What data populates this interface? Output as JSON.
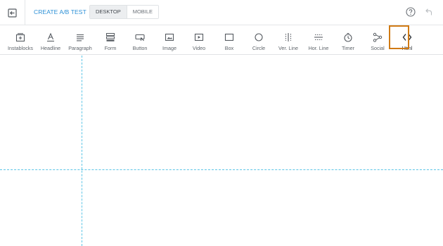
{
  "header": {
    "ab_test_label": "CREATE A/B TEST",
    "view_options": [
      "DESKTOP",
      "MOBILE"
    ],
    "active_view": "DESKTOP"
  },
  "toolbar": {
    "items": [
      {
        "label": "Instablocks",
        "icon": "instablocks-icon"
      },
      {
        "label": "Headline",
        "icon": "headline-icon"
      },
      {
        "label": "Paragraph",
        "icon": "paragraph-icon"
      },
      {
        "label": "Form",
        "icon": "form-icon"
      },
      {
        "label": "Button",
        "icon": "button-icon"
      },
      {
        "label": "Image",
        "icon": "image-icon"
      },
      {
        "label": "Video",
        "icon": "video-icon"
      },
      {
        "label": "Box",
        "icon": "box-icon"
      },
      {
        "label": "Circle",
        "icon": "circle-icon"
      },
      {
        "label": "Ver. Line",
        "icon": "vertical-line-icon"
      },
      {
        "label": "Hor. Line",
        "icon": "horizontal-line-icon"
      },
      {
        "label": "Timer",
        "icon": "timer-icon"
      },
      {
        "label": "Social",
        "icon": "social-icon"
      },
      {
        "label": "Html",
        "icon": "html-code-icon"
      }
    ],
    "selected": "Html",
    "highlight_color": "#d07a14"
  },
  "colors": {
    "accent": "#2a8fd6",
    "guide": "#5cc5e6"
  }
}
